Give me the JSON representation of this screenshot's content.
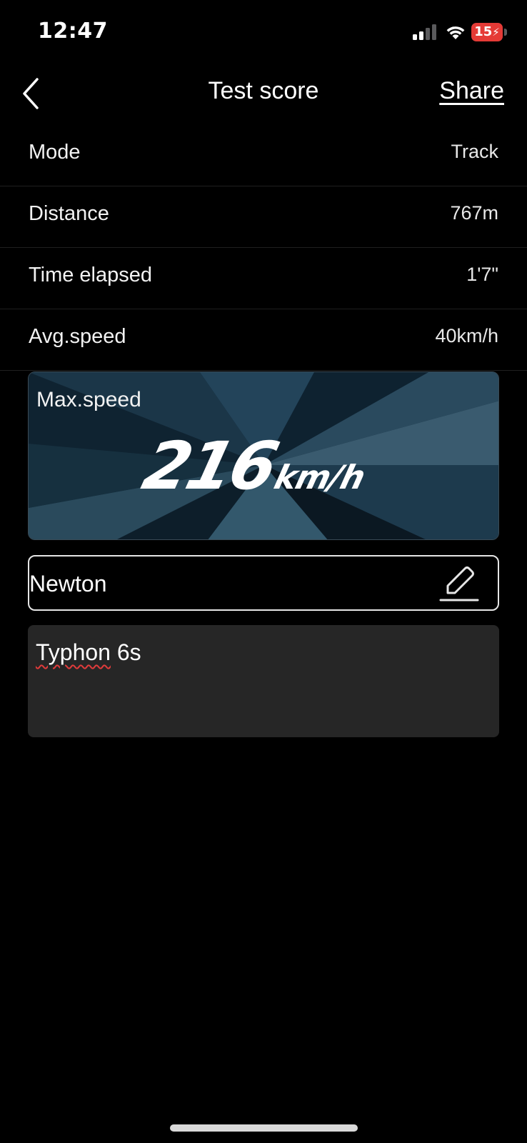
{
  "status_bar": {
    "time": "12:47",
    "battery_level": "15",
    "signal_icon": "cellular-signal-icon",
    "wifi_icon": "wifi-icon",
    "battery_icon": "battery-charging-icon"
  },
  "nav": {
    "title": "Test score",
    "share_label": "Share",
    "back_icon": "chevron-left-icon"
  },
  "stats": [
    {
      "label": "Mode",
      "value": "Track"
    },
    {
      "label": "Distance",
      "value": "767m"
    },
    {
      "label": "Time elapsed",
      "value": "1'7\""
    },
    {
      "label": "Avg.speed",
      "value": "40km/h"
    }
  ],
  "max_speed": {
    "label": "Max.speed",
    "value": "216",
    "unit": "km/h"
  },
  "name_field": {
    "value": "Newton",
    "edit_icon": "pencil-edit-icon"
  },
  "note": {
    "misspelled_word": "Typhon",
    "rest": " 6s"
  },
  "colors": {
    "background": "#000000",
    "note_background": "#262626",
    "battery_low": "#e53a36",
    "card_background": "#142a38"
  }
}
